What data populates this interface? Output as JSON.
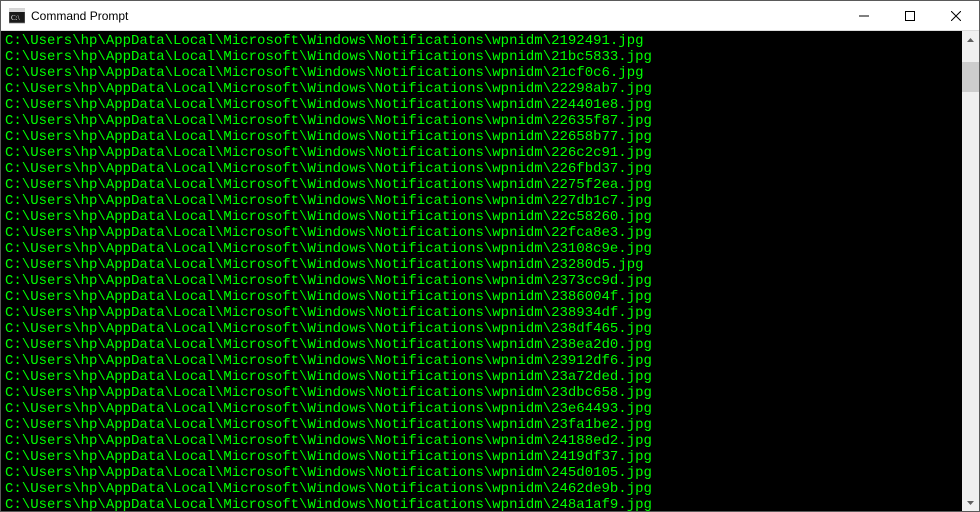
{
  "window": {
    "title": "Command Prompt"
  },
  "colors": {
    "text": "#00ff00",
    "background": "#000000"
  },
  "path_prefix": "C:\\Users\\hp\\AppData\\Local\\Microsoft\\Windows\\Notifications\\wpnidm\\",
  "files": [
    "2192491.jpg",
    "21bc5833.jpg",
    "21cf0c6.jpg",
    "22298ab7.jpg",
    "224401e8.jpg",
    "22635f87.jpg",
    "22658b77.jpg",
    "226c2c91.jpg",
    "226fbd37.jpg",
    "2275f2ea.jpg",
    "227db1c7.jpg",
    "22c58260.jpg",
    "22fca8e3.jpg",
    "23108c9e.jpg",
    "23280d5.jpg",
    "2373cc9d.jpg",
    "2386004f.jpg",
    "238934df.jpg",
    "238df465.jpg",
    "238ea2d0.jpg",
    "23912df6.jpg",
    "23a72ded.jpg",
    "23dbc658.jpg",
    "23e64493.jpg",
    "23fa1be2.jpg",
    "24188ed2.jpg",
    "2419df37.jpg",
    "245d0105.jpg",
    "2462de9b.jpg",
    "248a1af9.jpg"
  ]
}
